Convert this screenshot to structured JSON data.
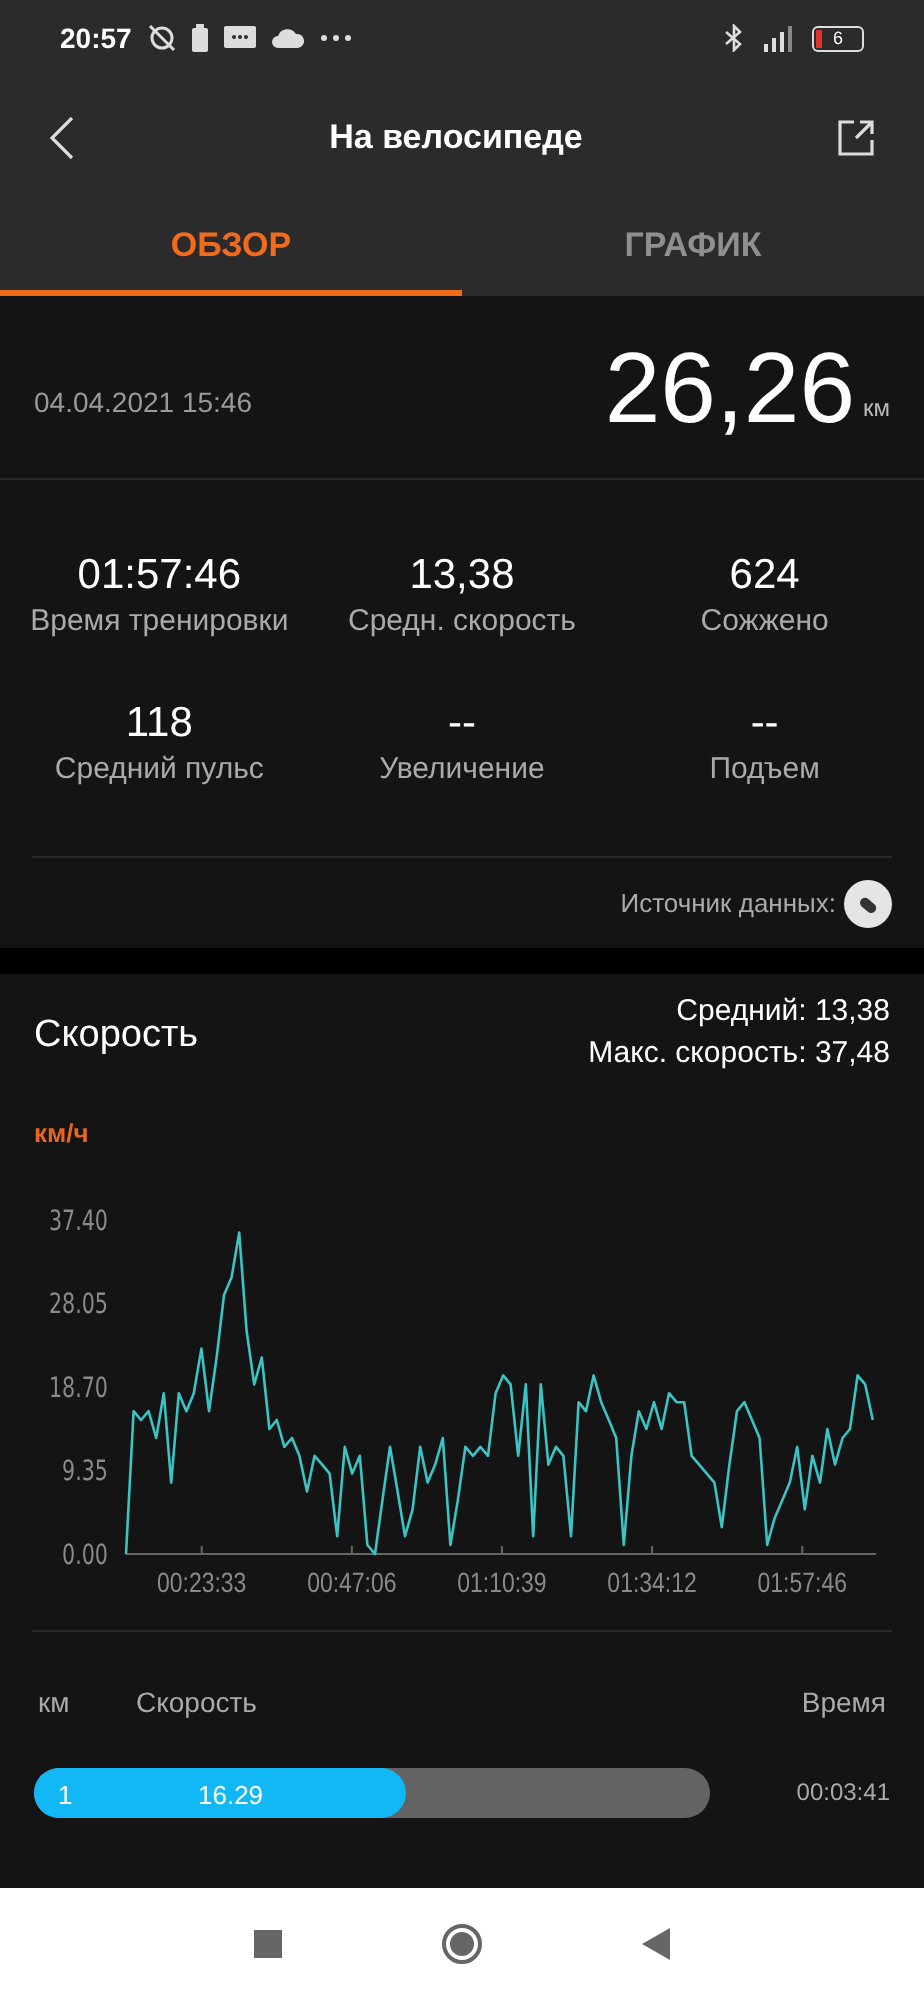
{
  "status_bar": {
    "time": "20:57",
    "battery": "6"
  },
  "header": {
    "title": "На велосипеде"
  },
  "tabs": [
    {
      "label": "ОБЗОР",
      "selected": true
    },
    {
      "label": "ГРАФИК",
      "selected": false
    }
  ],
  "summary": {
    "date": "04.04.2021 15:46",
    "distance": "26,26",
    "unit": "км"
  },
  "stats": [
    {
      "value": "01:57:46",
      "label": "Время тренировки"
    },
    {
      "value": "13,38",
      "label": "Средн. скорость"
    },
    {
      "value": "624",
      "label": "Сожжено"
    },
    {
      "value": "118",
      "label": "Средний пульс"
    },
    {
      "value": "--",
      "label": "Увеличение"
    },
    {
      "value": "--",
      "label": "Подъем"
    }
  ],
  "data_source": {
    "label": "Источник данных:"
  },
  "speed": {
    "title": "Скорость",
    "average": "Средний: 13,38",
    "max": "Макс. скорость: 37,48",
    "chart_data": {
      "type": "line",
      "ylabel": "км/ч",
      "xlim": [
        700,
        7760
      ],
      "ylim": [
        0,
        37.4
      ],
      "yticks": [
        {
          "value": 0,
          "label": "0.00"
        },
        {
          "value": 9.35,
          "label": "9.35"
        },
        {
          "value": 18.7,
          "label": "18.70"
        },
        {
          "value": 28.05,
          "label": "28.05"
        },
        {
          "value": 37.4,
          "label": "37.40"
        }
      ],
      "xticks": [
        {
          "value": 1413,
          "label": "00:23:33"
        },
        {
          "value": 2826,
          "label": "00:47:06"
        },
        {
          "value": 4239,
          "label": "01:10:39"
        },
        {
          "value": 5652,
          "label": "01:34:12"
        },
        {
          "value": 7066,
          "label": "01:57:46"
        }
      ],
      "x": [
        700,
        771,
        842,
        913,
        984,
        1055,
        1126,
        1197,
        1268,
        1339,
        1410,
        1481,
        1552,
        1623,
        1694,
        1765,
        1836,
        1907,
        1978,
        2049,
        2120,
        2191,
        2262,
        2333,
        2404,
        2475,
        2546,
        2617,
        2688,
        2759,
        2830,
        2901,
        2972,
        3043,
        3114,
        3185,
        3256,
        3327,
        3398,
        3469,
        3540,
        3611,
        3682,
        3753,
        3824,
        3895,
        3966,
        4037,
        4108,
        4179,
        4250,
        4321,
        4392,
        4463,
        4534,
        4605,
        4676,
        4747,
        4818,
        4889,
        4960,
        5031,
        5102,
        5173,
        5244,
        5315,
        5386,
        5457,
        5528,
        5599,
        5670,
        5741,
        5812,
        5883,
        5954,
        6025,
        6096,
        6167,
        6238,
        6309,
        6380,
        6451,
        6522,
        6593,
        6664,
        6735,
        6806,
        6877,
        6948,
        7019,
        7090,
        7161,
        7232,
        7303,
        7374,
        7445,
        7516,
        7587,
        7658,
        7729
      ],
      "series": [
        {
          "color": "#3cc4c4",
          "values": [
            0,
            16,
            15,
            16,
            13,
            18,
            8,
            18,
            16,
            18,
            23,
            16,
            22,
            29,
            31,
            36,
            25,
            19,
            22,
            14,
            15,
            12,
            13,
            11,
            7,
            11,
            10,
            9,
            2,
            12,
            9,
            11,
            1,
            0,
            6,
            12,
            7,
            2,
            5,
            12,
            8,
            10,
            13,
            1,
            6,
            12,
            11,
            12,
            11,
            18,
            20,
            19,
            11,
            19,
            2,
            19,
            10,
            12,
            11,
            2,
            17,
            16,
            20,
            17,
            15,
            13,
            1,
            11,
            16,
            14,
            17,
            14,
            18,
            17,
            17,
            11,
            10,
            9,
            8,
            3,
            10,
            16,
            17,
            15,
            13,
            1,
            4,
            6,
            8,
            12,
            5,
            11,
            8,
            14,
            10,
            13,
            14,
            20,
            19,
            15
          ]
        }
      ]
    }
  },
  "laps": {
    "columns": [
      "км",
      "Скорость",
      "Время"
    ],
    "rows": [
      {
        "km": "1",
        "speed": "16.29",
        "time": "00:03:41",
        "level": 0.55
      }
    ]
  }
}
